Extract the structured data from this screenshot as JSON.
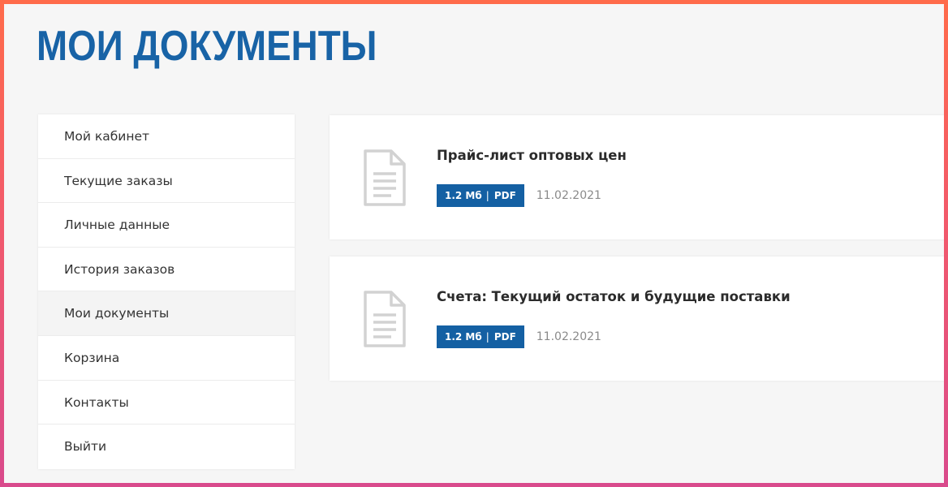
{
  "page": {
    "title": "МОИ ДОКУМЕНТЫ"
  },
  "sidebar": {
    "items": [
      {
        "label": "Мой кабинет",
        "active": false
      },
      {
        "label": "Текущие заказы",
        "active": false
      },
      {
        "label": "Личные данные",
        "active": false
      },
      {
        "label": "История заказов",
        "active": false
      },
      {
        "label": "Мои документы",
        "active": true
      },
      {
        "label": "Корзина",
        "active": false
      },
      {
        "label": "Контакты",
        "active": false
      },
      {
        "label": "Выйти",
        "active": false
      }
    ]
  },
  "documents": [
    {
      "icon": "document-icon",
      "title": "Прайс-лист оптовых цен",
      "size": "1.2 Мб",
      "separator": "|",
      "format": "PDF",
      "date": "11.02.2021"
    },
    {
      "icon": "document-icon",
      "title": "Счета: Текущий остаток и будущие поставки",
      "size": "1.2 Мб",
      "separator": "|",
      "format": "PDF",
      "date": "11.02.2021"
    }
  ],
  "colors": {
    "accent": "#1863a6",
    "badge": "#1460a3",
    "frame_top": "#ff6b4a",
    "frame_bottom": "#d94a8c"
  }
}
